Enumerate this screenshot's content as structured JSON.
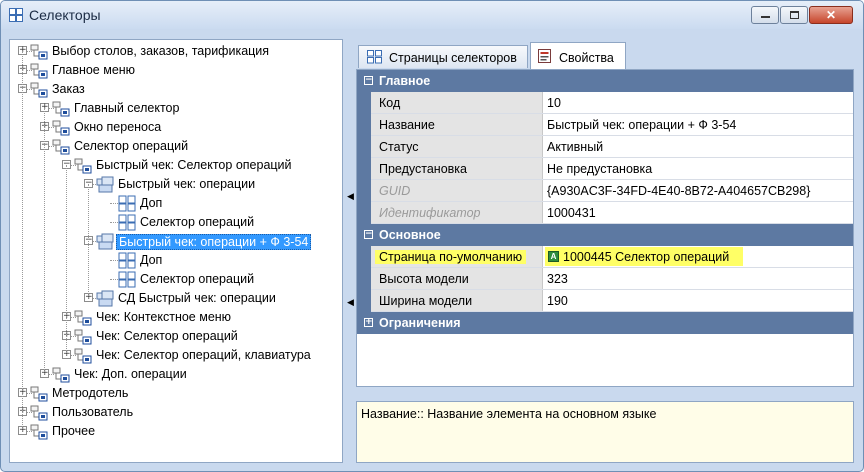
{
  "window": {
    "title": "Селекторы"
  },
  "tree": [
    {
      "label": "Выбор столов, заказов, тарификация",
      "level": 0,
      "expander": "+",
      "icon": "folder-node-icon"
    },
    {
      "label": "Главное меню",
      "level": 0,
      "expander": "+",
      "icon": "folder-node-icon"
    },
    {
      "label": "Заказ",
      "level": 0,
      "expander": "−",
      "icon": "folder-node-icon"
    },
    {
      "label": "Главный селектор",
      "level": 1,
      "expander": "+",
      "icon": "folder-node-icon"
    },
    {
      "label": "Окно переноса",
      "level": 1,
      "expander": "+",
      "icon": "folder-node-icon"
    },
    {
      "label": "Селектор операций",
      "level": 1,
      "expander": "−",
      "icon": "folder-node-icon"
    },
    {
      "label": "Быстрый чек: Селектор операций",
      "level": 2,
      "expander": "−",
      "icon": "folder-node-icon"
    },
    {
      "label": "Быстрый чек: операции",
      "level": 3,
      "expander": "−",
      "icon": "selector-node-icon"
    },
    {
      "label": "Доп",
      "level": 4,
      "expander": "",
      "icon": "grid-node-icon"
    },
    {
      "label": "Селектор операций",
      "level": 4,
      "expander": "",
      "icon": "grid-node-icon"
    },
    {
      "label": "Быстрый чек: операции + Ф 3-54",
      "level": 3,
      "expander": "−",
      "icon": "selector-node-icon",
      "selected": true
    },
    {
      "label": "Доп",
      "level": 4,
      "expander": "",
      "icon": "grid-node-icon"
    },
    {
      "label": "Селектор операций",
      "level": 4,
      "expander": "",
      "icon": "grid-node-icon"
    },
    {
      "label": "СД Быстрый чек: операции",
      "level": 3,
      "expander": "+",
      "icon": "selector-node-icon"
    },
    {
      "label": "Чек: Контекстное меню",
      "level": 2,
      "expander": "+",
      "icon": "folder-node-icon"
    },
    {
      "label": "Чек: Селектор операций",
      "level": 2,
      "expander": "+",
      "icon": "folder-node-icon"
    },
    {
      "label": "Чек: Селектор операций, клавиатура",
      "level": 2,
      "expander": "+",
      "icon": "folder-node-icon"
    },
    {
      "label": "Чек: Доп. операции",
      "level": 1,
      "expander": "+",
      "icon": "folder-node-icon"
    },
    {
      "label": "Метродотель",
      "level": 0,
      "expander": "+",
      "icon": "folder-node-icon"
    },
    {
      "label": "Пользователь",
      "level": 0,
      "expander": "+",
      "icon": "folder-node-icon"
    },
    {
      "label": "Прочее",
      "level": 0,
      "expander": "+",
      "icon": "folder-node-icon"
    }
  ],
  "tabs": [
    {
      "label": "Страницы селекторов",
      "active": false,
      "icon": "pages-icon"
    },
    {
      "label": "Свойства",
      "active": true,
      "icon": "properties-icon"
    }
  ],
  "grid": [
    {
      "type": "category",
      "label": "Главное",
      "expanded": true
    },
    {
      "type": "prop",
      "name": "Код",
      "value": "10"
    },
    {
      "type": "prop",
      "name": "Название",
      "value": "Быстрый чек: операции + Ф 3-54"
    },
    {
      "type": "prop",
      "name": "Статус",
      "value": "Активный"
    },
    {
      "type": "prop",
      "name": "Предустановка",
      "value": "Не предустановка"
    },
    {
      "type": "prop",
      "name": "GUID",
      "value": "{A930AC3F-34FD-4E40-8B72-A404657CB298}",
      "disabled": true
    },
    {
      "type": "prop",
      "name": "Идентификатор",
      "value": "1000431",
      "disabled": true
    },
    {
      "type": "category",
      "label": "Основное",
      "expanded": true
    },
    {
      "type": "prop",
      "name": "Страница по-умолчанию",
      "value": "1000445 Селектор операций",
      "highlight": true,
      "badge": "A"
    },
    {
      "type": "prop",
      "name": "Высота модели",
      "value": "323"
    },
    {
      "type": "prop",
      "name": "Ширина модели",
      "value": "190"
    },
    {
      "type": "category",
      "label": "Ограничения",
      "expanded": false
    }
  ],
  "description": "Название:: Название элемента на основном языке",
  "colors": {
    "category": "#5d79a2",
    "highlight": "#ffff66",
    "selection": "#3399ff"
  }
}
